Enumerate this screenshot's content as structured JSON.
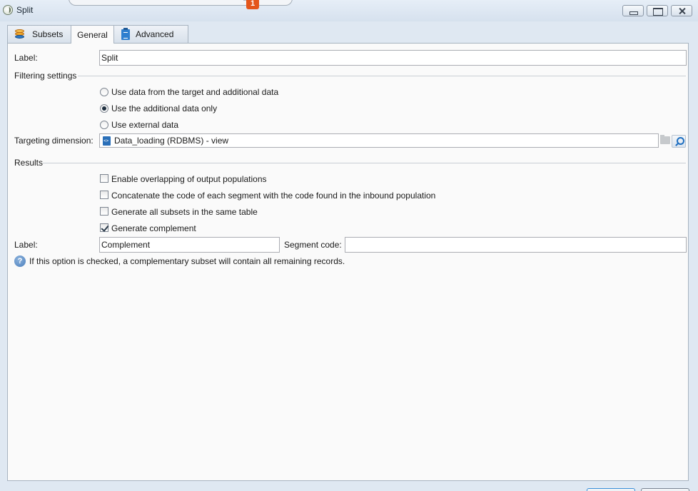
{
  "window": {
    "title": "Split",
    "notification_count": "1"
  },
  "tabs": [
    {
      "label": "Subsets",
      "icon": "database-icon"
    },
    {
      "label": "General",
      "icon": null,
      "active": true
    },
    {
      "label": "Advanced",
      "icon": "clipboard-icon"
    }
  ],
  "general": {
    "label_caption": "Label:",
    "label_value": "Split",
    "filtering_section": "Filtering settings",
    "filter_options": [
      {
        "label": "Use data from the target and additional data",
        "selected": false
      },
      {
        "label": "Use the additional data only",
        "selected": true
      },
      {
        "label": "Use external data",
        "selected": false
      }
    ],
    "targeting_caption": "Targeting dimension:",
    "targeting_value": "Data_loading (RDBMS) - view",
    "results_section": "Results",
    "result_options": [
      {
        "label": "Enable overlapping of output populations",
        "checked": false
      },
      {
        "label": "Concatenate the code of each segment with the code found in the inbound population",
        "checked": false
      },
      {
        "label": "Generate all subsets in the same table",
        "checked": false
      },
      {
        "label": "Generate complement",
        "checked": true
      }
    ],
    "complement_label_caption": "Label:",
    "complement_label_value": "Complement",
    "segment_code_caption": "Segment code:",
    "segment_code_value": "",
    "help_text": "If this option is checked, a complementary subset will contain all remaining records."
  },
  "colors": {
    "badge": "#e4561b",
    "accent": "#1f6fc0"
  }
}
